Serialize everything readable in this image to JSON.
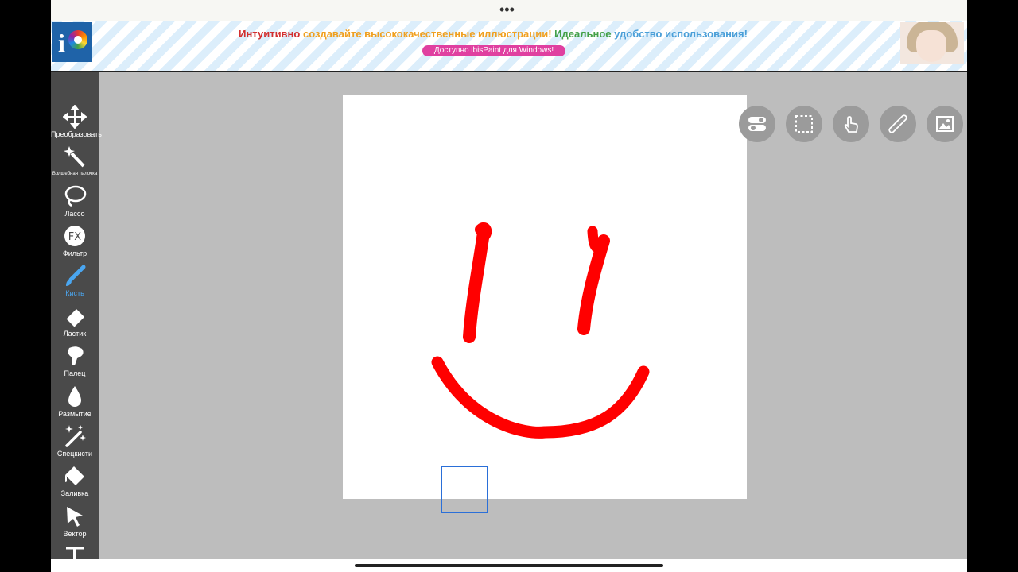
{
  "status_bar": {
    "dots": "•••"
  },
  "banner": {
    "word1": "Интуитивно",
    "word2": "создавайте высококачественные иллюстрации!",
    "word3": "Идеальное",
    "word4": "удобство использования!",
    "pill": "Доступно ibisPaint для Windows!"
  },
  "toolbar": {
    "items": [
      {
        "label": "Преобразовать",
        "icon": "move-icon"
      },
      {
        "label": "Волшебная палочка",
        "icon": "magic-wand-icon"
      },
      {
        "label": "Лассо",
        "icon": "lasso-icon"
      },
      {
        "label": "Фильтр",
        "icon": "fx-icon"
      },
      {
        "label": "Кисть",
        "icon": "brush-icon",
        "active": true
      },
      {
        "label": "Ластик",
        "icon": "eraser-icon"
      },
      {
        "label": "Палец",
        "icon": "smudge-icon"
      },
      {
        "label": "Размытие",
        "icon": "blur-drop-icon"
      },
      {
        "label": "Спецкисти",
        "icon": "special-brush-icon"
      },
      {
        "label": "Заливка",
        "icon": "fill-bucket-icon"
      },
      {
        "label": "Вектор",
        "icon": "vector-arrow-icon"
      },
      {
        "label": "",
        "icon": "text-icon"
      }
    ]
  },
  "floating_buttons": [
    "toggle-icon",
    "selection-icon",
    "touch-icon",
    "ruler-icon",
    "image-icon"
  ],
  "colors": {
    "brush_stroke": "#ff0000",
    "active_tool": "#4aa6f0",
    "toolbar_bg": "#4a4a4a",
    "workspace_bg": "#bdbdbd"
  }
}
